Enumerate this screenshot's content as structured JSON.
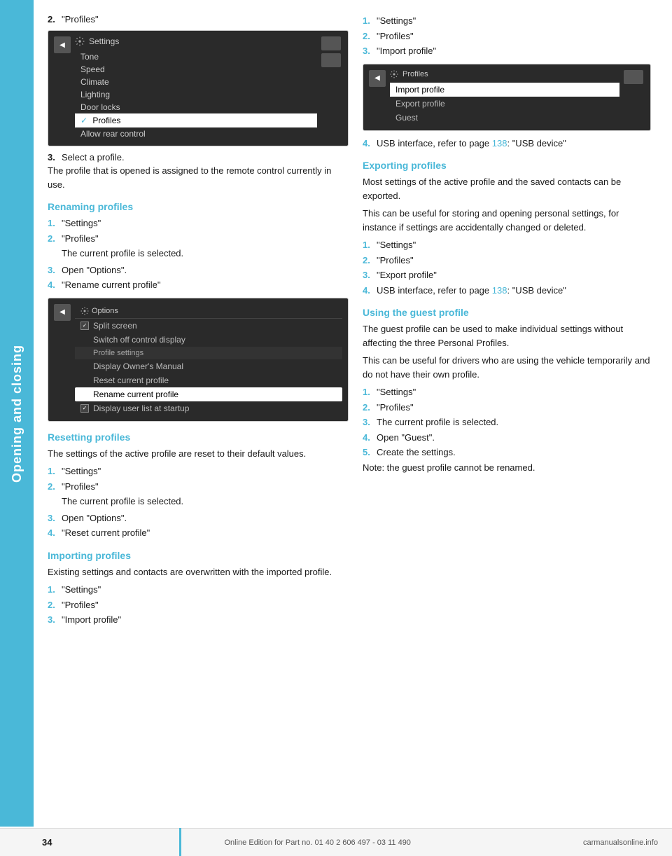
{
  "sidebar": {
    "label": "Opening and closing"
  },
  "left_col": {
    "step2_label": "\"Profiles\"",
    "step3_label": "Select a profile.",
    "step3_desc": "The profile that is opened is assigned to the remote control currently in use.",
    "renaming_heading": "Renaming profiles",
    "renaming_steps": [
      {
        "num": "1.",
        "text": "\"Settings\""
      },
      {
        "num": "2.",
        "text": "\"Profiles\""
      },
      {
        "num": "3.",
        "text": "Open \"Options\"."
      },
      {
        "num": "4.",
        "text": "\"Rename current profile\""
      }
    ],
    "renaming_indent": "The current profile is selected.",
    "resetting_heading": "Resetting profiles",
    "resetting_desc": "The settings of the active profile are reset to their default values.",
    "resetting_steps": [
      {
        "num": "1.",
        "text": "\"Settings\""
      },
      {
        "num": "2.",
        "text": "\"Profiles\""
      },
      {
        "num": "3.",
        "text": "Open \"Options\"."
      },
      {
        "num": "4.",
        "text": "\"Reset current profile\""
      }
    ],
    "resetting_indent": "The current profile is selected.",
    "importing_heading": "Importing profiles",
    "importing_desc": "Existing settings and contacts are overwritten with the imported profile.",
    "importing_steps": [
      {
        "num": "1.",
        "text": "\"Settings\""
      },
      {
        "num": "2.",
        "text": "\"Profiles\""
      },
      {
        "num": "3.",
        "text": "\"Import profile\""
      }
    ],
    "importing_step4": {
      "num": "4.",
      "text_pre": "USB interface, refer to page ",
      "link": "138",
      "text_post": ": \"USB device\""
    }
  },
  "right_col": {
    "exporting_heading": "Exporting profiles",
    "exporting_desc1": "Most settings of the active profile and the saved contacts can be exported.",
    "exporting_desc2": "This can be useful for storing and opening personal settings, for instance if settings are accidentally changed or deleted.",
    "exporting_steps": [
      {
        "num": "1.",
        "text": "\"Settings\""
      },
      {
        "num": "2.",
        "text": "\"Profiles\""
      },
      {
        "num": "3.",
        "text": "\"Export profile\""
      }
    ],
    "exporting_step4": {
      "num": "4.",
      "text_pre": "USB interface, refer to page ",
      "link": "138",
      "text_post": ": \"USB device\""
    },
    "guest_heading": "Using the guest profile",
    "guest_desc1": "The guest profile can be used to make individual settings without affecting the three Personal Profiles.",
    "guest_desc2": "This can be useful for drivers who are using the vehicle temporarily and do not have their own profile.",
    "guest_steps": [
      {
        "num": "1.",
        "text": "\"Settings\""
      },
      {
        "num": "2.",
        "text": "\"Profiles\""
      },
      {
        "num": "3.",
        "text": "The current profile is selected."
      },
      {
        "num": "4.",
        "text": "Open \"Guest\"."
      },
      {
        "num": "5.",
        "text": "Create the settings."
      }
    ],
    "guest_note": "Note: the guest profile cannot be renamed."
  },
  "settings_screen": {
    "title": "Settings",
    "items": [
      "Tone",
      "Speed",
      "Climate",
      "Lighting",
      "Door locks",
      "Profiles",
      "Allow rear control"
    ],
    "selected": "Profiles"
  },
  "options_screen": {
    "title": "Options",
    "items": [
      {
        "label": "Split screen",
        "type": "checkbox",
        "checked": true
      },
      {
        "label": "Switch off control display",
        "type": "plain"
      },
      {
        "label": "Profile settings",
        "type": "header"
      },
      {
        "label": "Display Owner's Manual",
        "type": "plain"
      },
      {
        "label": "Reset current profile",
        "type": "plain"
      },
      {
        "label": "Rename current profile",
        "type": "highlighted"
      },
      {
        "label": "Display user list at startup",
        "type": "checkbox",
        "checked": true
      }
    ]
  },
  "profiles_screen": {
    "title": "Profiles",
    "items": [
      "Import profile",
      "Export profile",
      "Guest"
    ],
    "selected": "Import profile"
  },
  "footer": {
    "page_number": "34",
    "text": "Online Edition for Part no. 01 40 2 606 497 - 03 11 490",
    "logo": "carmanualsonline.info"
  }
}
